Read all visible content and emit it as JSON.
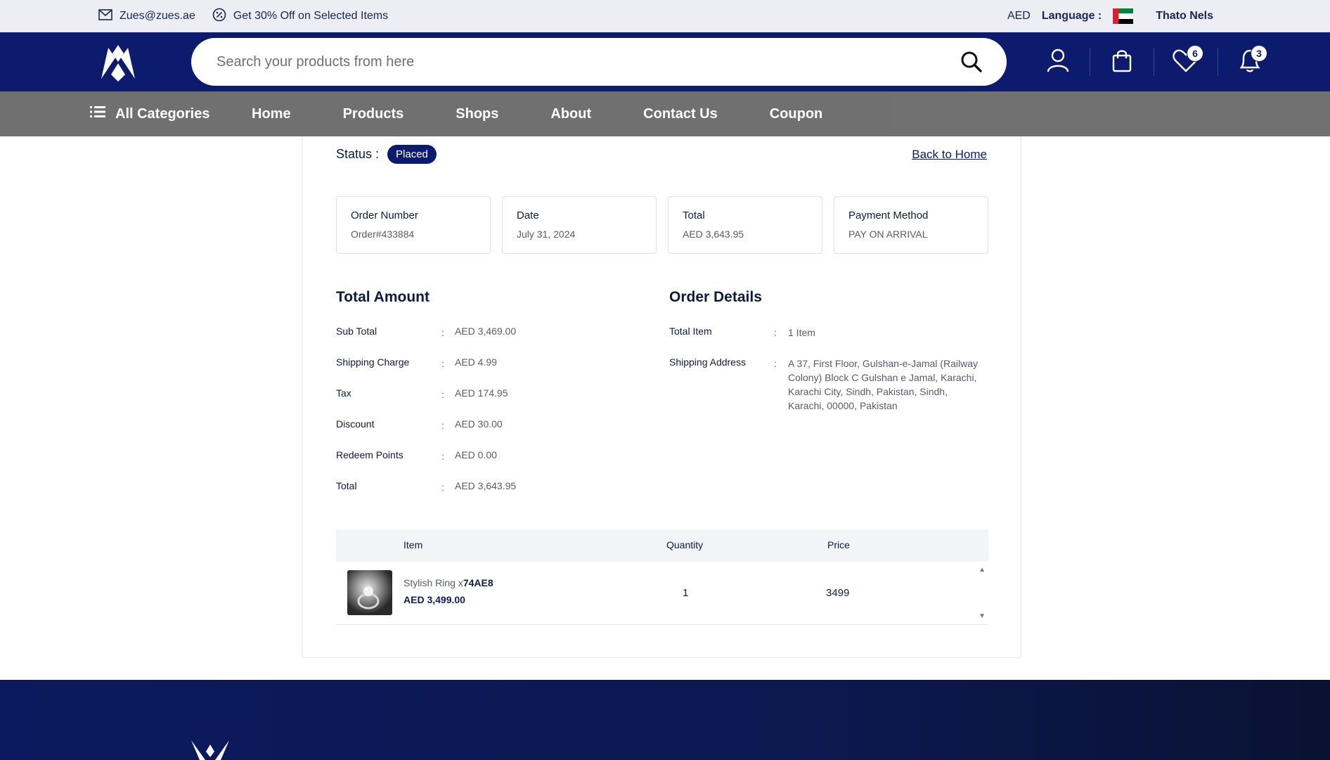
{
  "topbar": {
    "email": "Zues@zues.ae",
    "promo": "Get 30% Off on Selected Items",
    "currency": "AED",
    "language_label": "Language :",
    "user_name": "Thato Nels"
  },
  "header": {
    "search_placeholder": "Search your products from here",
    "wishlist_count": "6",
    "notification_count": "3"
  },
  "nav": {
    "categories_label": "All Categories",
    "links": [
      "Home",
      "Products",
      "Shops",
      "About",
      "Contact Us",
      "Coupon"
    ]
  },
  "order": {
    "status_label": "Status :",
    "status_value": "Placed",
    "back_label": "Back to Home",
    "summary": [
      {
        "title": "Order Number",
        "value": "Order#433884"
      },
      {
        "title": "Date",
        "value": "July 31, 2024"
      },
      {
        "title": "Total",
        "value": "AED 3,643.95"
      },
      {
        "title": "Payment Method",
        "value": "PAY ON ARRIVAL"
      }
    ],
    "total_amount_title": "Total Amount",
    "amounts": [
      {
        "label": "Sub Total",
        "value": "AED 3,469.00"
      },
      {
        "label": "Shipping Charge",
        "value": "AED 4.99"
      },
      {
        "label": "Tax",
        "value": "AED 174.95"
      },
      {
        "label": "Discount",
        "value": "AED 30.00"
      },
      {
        "label": "Redeem Points",
        "value": "AED 0.00"
      },
      {
        "label": "Total",
        "value": "AED 3,643.95"
      }
    ],
    "order_details_title": "Order Details",
    "details": [
      {
        "label": "Total Item",
        "value": "1 Item"
      },
      {
        "label": "Shipping Address",
        "value": "A 37, First Floor, Gulshan-e-Jamal (Railway Colony) Block C Gulshan e Jamal, Karachi, Karachi City, Sindh, Pakistan, Sindh, Karachi, 00000, Pakistan"
      }
    ],
    "separator": ":",
    "table": {
      "headers": {
        "item": "Item",
        "quantity": "Quantity",
        "price": "Price"
      },
      "rows": [
        {
          "name": "Stylish Ring x",
          "code": "74AE8",
          "unit_price": "AED 3,499.00",
          "quantity": "1",
          "price": "3499"
        }
      ]
    }
  },
  "colors": {
    "brand_navy": "#0d1b6e",
    "nav_gray": "#6e6e6e"
  }
}
